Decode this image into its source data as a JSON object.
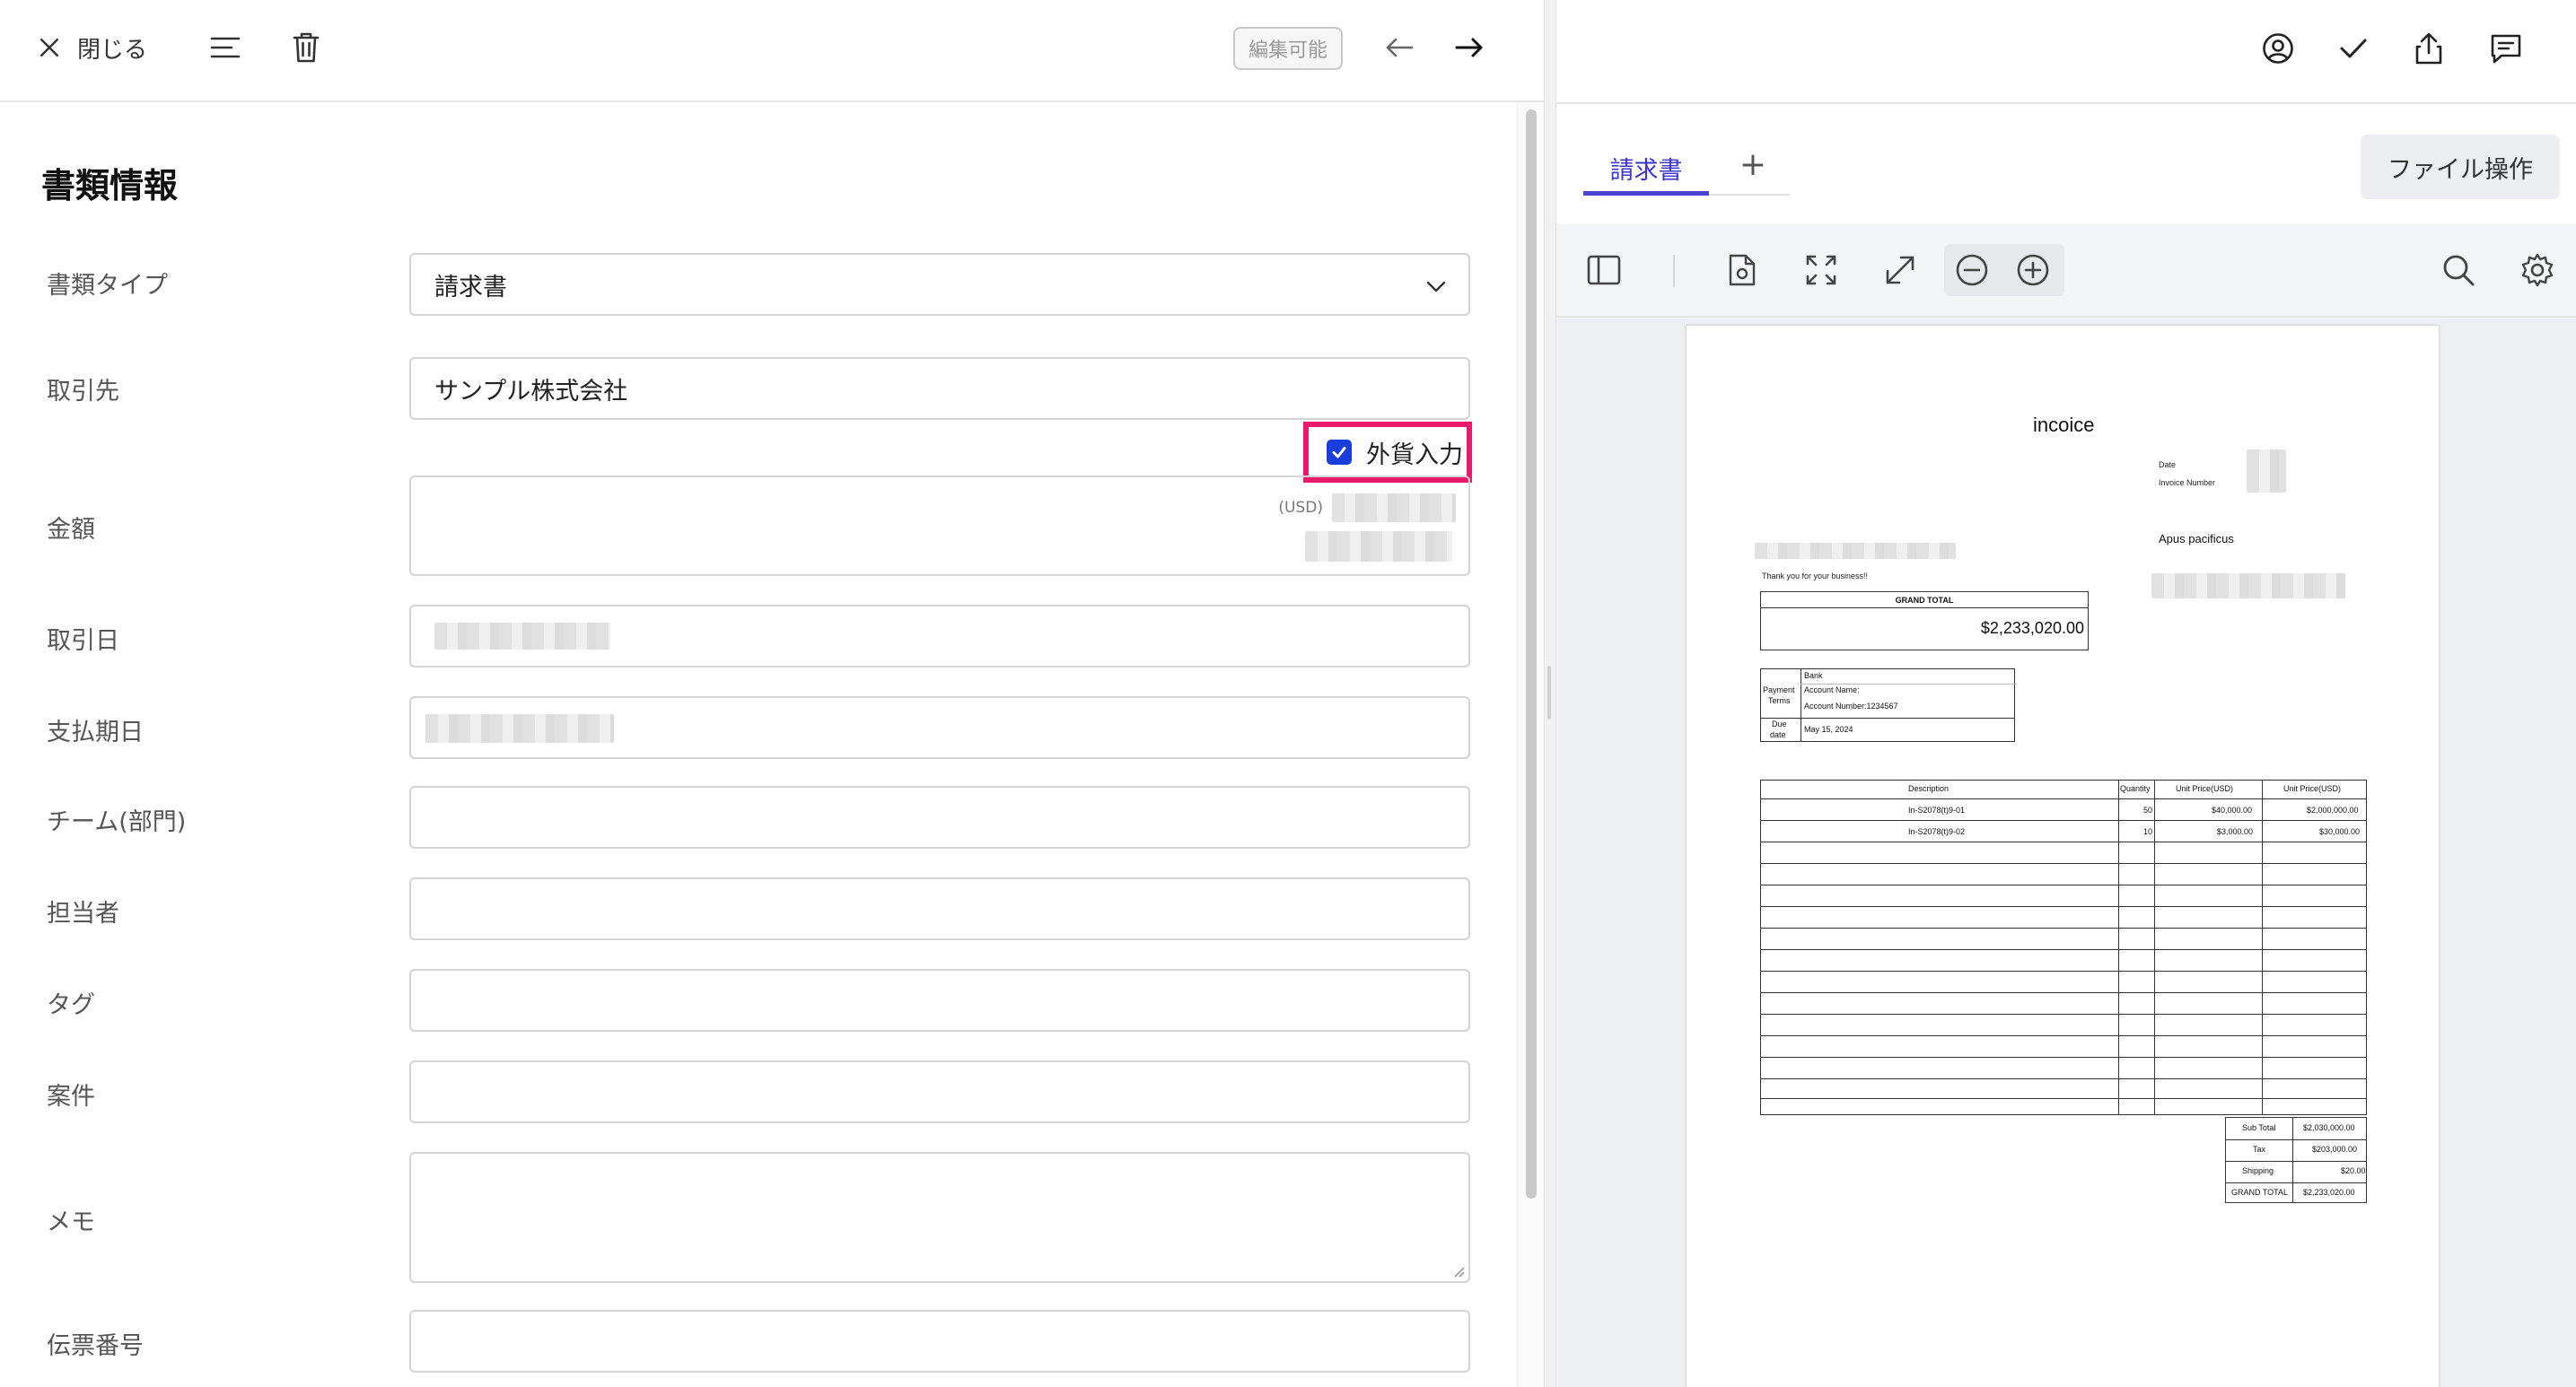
{
  "topbar": {
    "close_label": "閉じる",
    "editable_label": "編集可能",
    "icons": [
      "close-icon",
      "menu-icon",
      "trash-icon",
      "arrow-left-icon",
      "arrow-right-icon"
    ]
  },
  "form": {
    "section_title": "書類情報",
    "doc_type": {
      "label": "書類タイプ",
      "value": "請求書"
    },
    "partner": {
      "label": "取引先",
      "value": "サンプル株式会社"
    },
    "foreign_currency": {
      "label": "外貨入力",
      "checked": true
    },
    "amount": {
      "label": "金額",
      "currency": "(USD)"
    },
    "transaction_date": {
      "label": "取引日"
    },
    "due_date": {
      "label": "支払期日"
    },
    "team": {
      "label": "チーム(部門)"
    },
    "assignee": {
      "label": "担当者"
    },
    "tag": {
      "label": "タグ"
    },
    "project": {
      "label": "案件"
    },
    "memo": {
      "label": "メモ"
    },
    "slip_number": {
      "label": "伝票番号"
    }
  },
  "viewer": {
    "tabs": [
      {
        "label": "請求書",
        "active": true
      }
    ],
    "add_tab_label": "+",
    "file_ops_label": "ファイル操作",
    "header_icons": [
      "user-circle-icon",
      "check-icon",
      "share-icon",
      "comment-icon"
    ],
    "toolbar_icons": [
      "sidebar-icon",
      "page-settings-icon",
      "fit-page-icon",
      "expand-icon",
      "zoom-out-icon",
      "zoom-in-icon",
      "search-icon",
      "gear-icon"
    ]
  },
  "invoice": {
    "title": "incoice",
    "date_label": "Date",
    "invoice_number_label": "Invoice Number",
    "recipient": "Apus pacificus",
    "thanks": "Thank you for your business!!",
    "grand_total_label": "GRAND TOTAL",
    "grand_total_value": "$2,233,020.00",
    "payment_terms_label_1": "Payment",
    "payment_terms_label_2": "Terms",
    "bank_label": "Bank",
    "account_name_label": "Account Name:",
    "account_number": "Account Number:1234567",
    "due_label_1": "Due",
    "due_label_2": "date",
    "due_value": "May 15, 2024",
    "columns": [
      "Description",
      "Quantity",
      "Unit Price(USD)",
      "Unit Price(USD)"
    ],
    "rows": [
      {
        "description": "In-S2078(t)9-01",
        "quantity": "50",
        "unit_price": "$40,000.00",
        "amount": "$2,000,000.00"
      },
      {
        "description": "In-S2078(t)9-02",
        "quantity": "10",
        "unit_price": "$3,000.00",
        "amount": "$30,000.00"
      }
    ],
    "totals": [
      {
        "label": "Sub Total",
        "value": "$2,030,000.00"
      },
      {
        "label": "Tax",
        "value": "$203,000.00"
      },
      {
        "label": "Shipping",
        "value": "$20.00"
      },
      {
        "label": "GRAND TOTAL",
        "value": "$2,233,020.00"
      }
    ]
  },
  "colors": {
    "accent": "#4a43d6",
    "highlight": "#ea1a6b",
    "checkbox": "#1a3edb"
  }
}
